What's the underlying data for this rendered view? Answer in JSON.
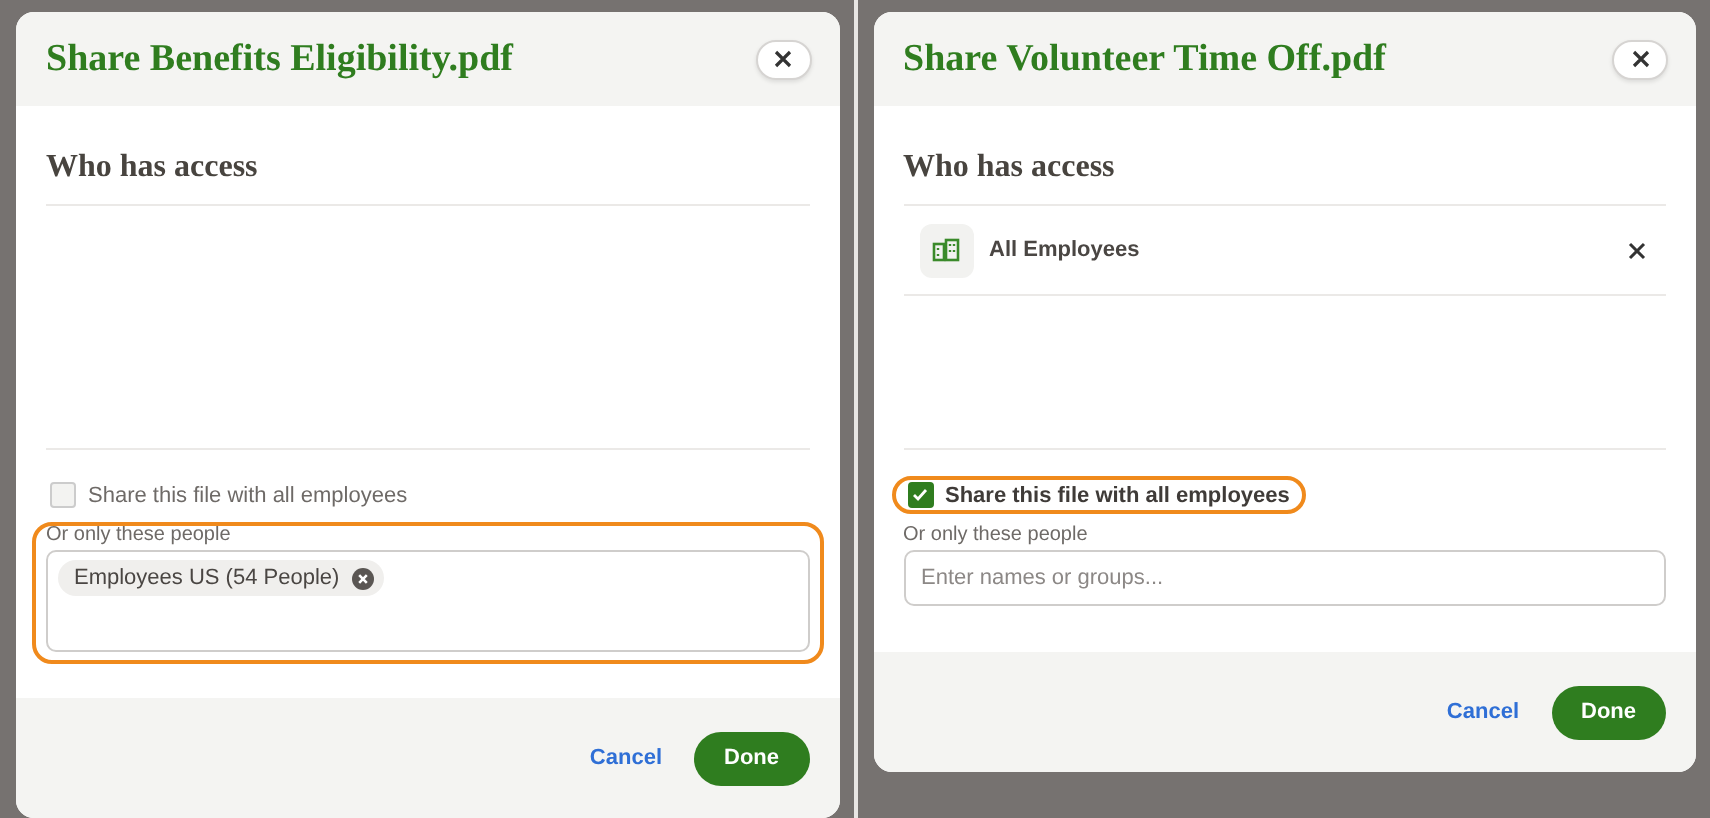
{
  "dialogs": [
    {
      "title": "Share Benefits Eligibility.pdf",
      "heading": "Who has access",
      "share_all": {
        "label": "Share this file with all employees",
        "checked": false
      },
      "people": {
        "label": "Or only these people",
        "chips": [
          "Employees US (54 People)"
        ],
        "highlighted": true
      },
      "cancel": "Cancel",
      "done": "Done"
    },
    {
      "title": "Share Volunteer Time Off.pdf",
      "heading": "Who has access",
      "access": [
        {
          "name": "All Employees"
        }
      ],
      "share_all": {
        "label": "Share this file with all employees",
        "checked": true,
        "highlighted": true
      },
      "people": {
        "label": "Or only these people",
        "placeholder": "Enter names or groups..."
      },
      "cancel": "Cancel",
      "done": "Done"
    }
  ]
}
